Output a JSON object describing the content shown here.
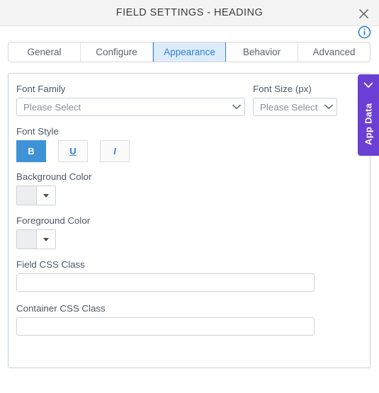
{
  "window": {
    "title": "FIELD SETTINGS - HEADING",
    "close_icon": "close-icon",
    "info_icon": "info-icon"
  },
  "tabs": {
    "items": [
      {
        "label": "General",
        "active": false
      },
      {
        "label": "Configure",
        "active": false
      },
      {
        "label": "Appearance",
        "active": true
      },
      {
        "label": "Behavior",
        "active": false
      },
      {
        "label": "Advanced",
        "active": false
      }
    ],
    "active_color": "#3083d4",
    "active_bg": "#ddecfb"
  },
  "form": {
    "font_family": {
      "label": "Font Family",
      "value": "Please Select",
      "caret_icon": "chevron-down-icon"
    },
    "font_size": {
      "label": "Font Size (px)",
      "value": "Please Select",
      "caret_icon": "chevron-down-icon"
    },
    "font_style": {
      "label": "Font Style",
      "buttons": [
        {
          "name": "bold",
          "glyph": "B",
          "active": true
        },
        {
          "name": "underline",
          "glyph": "U",
          "active": false
        },
        {
          "name": "italic",
          "glyph": "I",
          "active": false
        }
      ],
      "active_bg": "#3d93d5",
      "inactive_fg": "#3083d4"
    },
    "background_color": {
      "label": "Background Color",
      "swatch": "#eeeeee",
      "caret_icon": "triangle-down-icon"
    },
    "foreground_color": {
      "label": "Foreground Color",
      "swatch": "#eeeeee",
      "caret_icon": "triangle-down-icon"
    },
    "field_css_class": {
      "label": "Field CSS Class",
      "value": "",
      "placeholder": ""
    },
    "container_css_class": {
      "label": "Container CSS Class",
      "value": "",
      "placeholder": ""
    }
  },
  "app_data_tab": {
    "label": "App Data",
    "chevron_icon": "chevron-left-icon",
    "color": "#6b3ed4"
  }
}
